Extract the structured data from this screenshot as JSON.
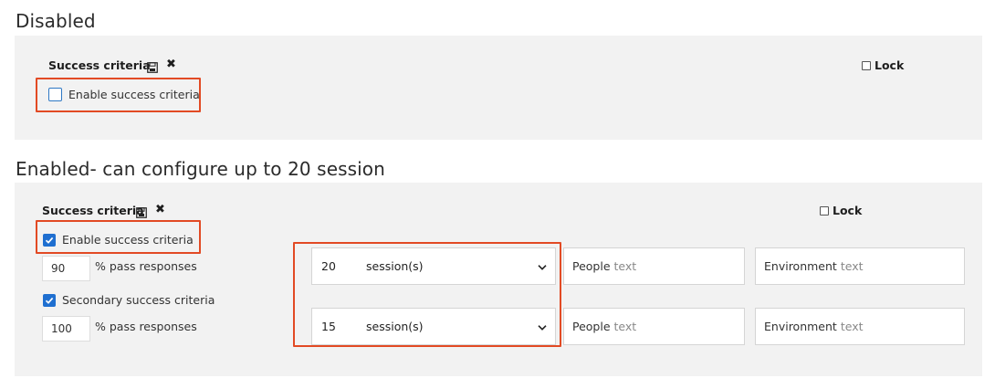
{
  "disabled_section": {
    "heading": "Disabled",
    "title": "Success criteria",
    "lock_label": "Lock",
    "enable_label": "Enable success criteria"
  },
  "enabled_section": {
    "heading": "Enabled- can configure up to 20 session",
    "title": "Success criteria",
    "lock_label": "Lock",
    "enable_label": "Enable success criteria",
    "primary_pass_value": "90",
    "secondary_label": "Secondary success criteria",
    "secondary_pass_value": "100",
    "pass_label": "% pass responses",
    "rows": [
      {
        "sessions": "20",
        "unit": "session(s)",
        "people_label": "People",
        "people_placeholder": "text",
        "env_label": "Environment",
        "env_placeholder": "text"
      },
      {
        "sessions": "15",
        "unit": "session(s)",
        "people_label": "People",
        "people_placeholder": "text",
        "env_label": "Environment",
        "env_placeholder": "text"
      }
    ]
  },
  "colors": {
    "highlight": "#e24a24",
    "checkbox_blue": "#1f6fd0",
    "panel_bg": "#f2f2f2"
  },
  "icons": [
    "save-icon",
    "close-icon",
    "chevron-down-icon",
    "checkmark-icon"
  ]
}
